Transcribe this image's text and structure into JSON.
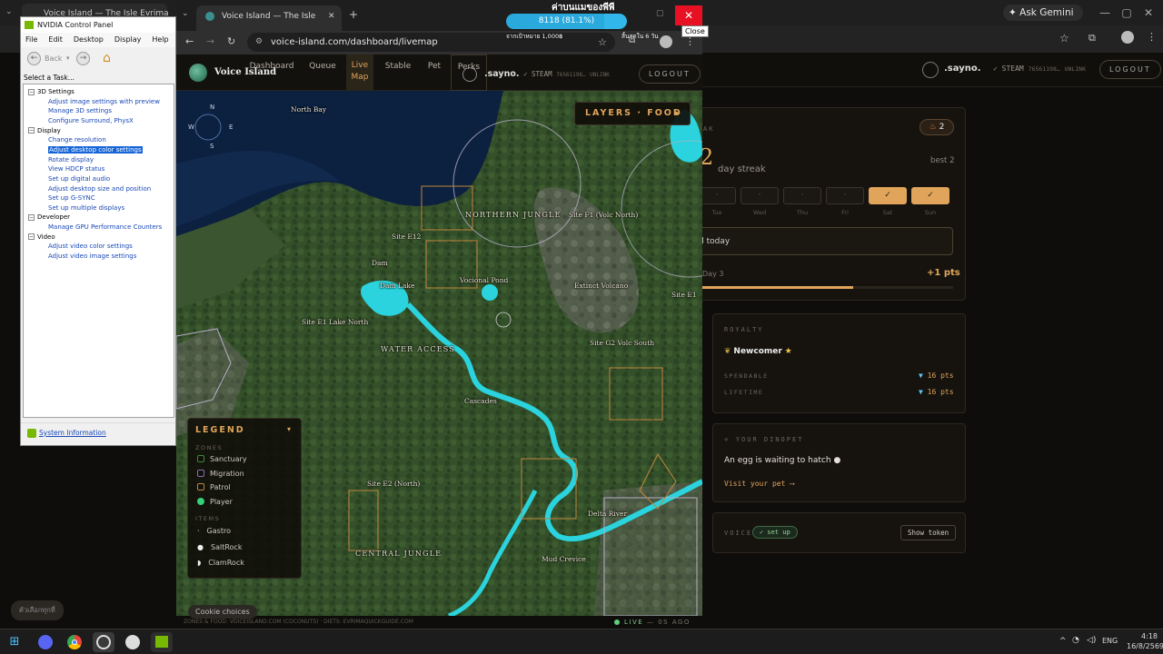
{
  "back_browser": {
    "tab_title": "Voice Island — The Isle Evrima",
    "ask_gemini": "Ask Gemini",
    "username": ".sayno.",
    "steam_label": "STEAM",
    "steam_id": "76561198…",
    "unlink": "UNLINK",
    "logout": "LOGOUT",
    "streak": {
      "section_label": "AK",
      "count_badge": "2",
      "big_number": "2",
      "subtitle": "day streak",
      "best": "best 2",
      "days": [
        "Tue",
        "Wed",
        "Thu",
        "Fri",
        "Sat",
        "Sun"
      ],
      "day_marks": [
        "·",
        "·",
        "·",
        "·",
        "✓",
        "✓"
      ],
      "claimed_text": "d today",
      "day_label": "Day 3",
      "points": "+1 pts",
      "progress": 0.6
    },
    "royalty": {
      "title": "ROYALTY",
      "rank": "Newcomer",
      "spendable_label": "SPENDABLE",
      "spendable_value": "16 pts",
      "lifetime_label": "LIFETIME",
      "lifetime_value": "16 pts"
    },
    "dinopet": {
      "title": "YOUR DINOPET",
      "message": "An egg is waiting to hatch",
      "link": "Visit your pet ⟶"
    },
    "voice": {
      "title": "VOICE",
      "status": "✓ set up",
      "button": "Show token"
    }
  },
  "nvidia": {
    "title": "NVIDIA Control Panel",
    "menu": [
      "File",
      "Edit",
      "Desktop",
      "Display",
      "Help"
    ],
    "back_label": "Back",
    "task_label": "Select a Task...",
    "tree": [
      {
        "type": "cat",
        "text": "3D Settings"
      },
      {
        "type": "link",
        "text": "Adjust image settings with preview"
      },
      {
        "type": "link",
        "text": "Manage 3D settings"
      },
      {
        "type": "link",
        "text": "Configure Surround, PhysX"
      },
      {
        "type": "cat",
        "text": "Display"
      },
      {
        "type": "link",
        "text": "Change resolution"
      },
      {
        "type": "sel",
        "text": "Adjust desktop color settings"
      },
      {
        "type": "link",
        "text": "Rotate display"
      },
      {
        "type": "link",
        "text": "View HDCP status"
      },
      {
        "type": "link",
        "text": "Set up digital audio"
      },
      {
        "type": "link",
        "text": "Adjust desktop size and position"
      },
      {
        "type": "link",
        "text": "Set up G-SYNC"
      },
      {
        "type": "link",
        "text": "Set up multiple displays"
      },
      {
        "type": "cat",
        "text": "Developer"
      },
      {
        "type": "link",
        "text": "Manage GPU Performance Counters"
      },
      {
        "type": "cat",
        "text": "Video"
      },
      {
        "type": "link",
        "text": "Adjust video color settings"
      },
      {
        "type": "link",
        "text": "Adjust video image settings"
      }
    ],
    "system_info": "System Information"
  },
  "front_browser": {
    "tab_title": "Voice Island — The Isle Evrima",
    "url": "voice-island.com/dashboard/livemap",
    "close_tooltip": "Close",
    "site_name": "Voice Island",
    "nav": [
      "Dashboard",
      "Queue",
      "Live Map",
      "Stable",
      "Pet",
      "Perks"
    ],
    "username": ".sayno.",
    "steam_label": "STEAM",
    "steam_id": "76561198…",
    "unlink": "UNLINK",
    "logout": "LOGOUT",
    "layers_button": "LAYERS · FOOD",
    "compass": [
      "N",
      "W",
      "E",
      "S"
    ],
    "legend": {
      "title": "LEGEND",
      "zones_label": "ZONES",
      "zones": [
        {
          "name": "Sanctuary",
          "color": "#3b8a3c"
        },
        {
          "name": "Migration",
          "color": "#8b6bb0"
        },
        {
          "name": "Patrol",
          "color": "#c0863d"
        },
        {
          "name": "Player",
          "color": "#35d07a"
        }
      ],
      "items_label": "ITEMS",
      "items": [
        "Gastro",
        "SaltRock",
        "ClamRock"
      ]
    },
    "map_labels": [
      "North Bay",
      "NORTHERN JUNGLE",
      "Site E12",
      "Dam",
      "Dam Lake",
      "Site E1 Lake North",
      "WATER ACCESS",
      "Cascades",
      "Site F1 (Volc North)",
      "Extinct Volcano",
      "Site G2 Volc South",
      "Site E1",
      "Vocional Pond",
      "Site E2 (North)",
      "CENTRAL JUNGLE",
      "Delta River",
      "Mud Crevice"
    ],
    "map_footer": "ZONES & FOOD: VOICEISLAND.COM (COCONUTS) · DIETS: EVRIMAQUICKGUIDE.COM",
    "live_label": "LIVE",
    "live_age": "— 0S AGO",
    "cookie_choices": "Cookie choices"
  },
  "overlay_gauge": {
    "title": "ค่าบนแมของพีพี",
    "value": "8118 (81.1%)",
    "left_caption": "จากเป้าหมาย 1,000฿",
    "right_caption": "สิ้นสุดใน 6 วัน",
    "fill": 0.811
  },
  "language_pill": "ตัวเลือกทุกที่",
  "taskbar": {
    "lang": "ENG",
    "time": "4:18",
    "date": "16/8/2569"
  }
}
